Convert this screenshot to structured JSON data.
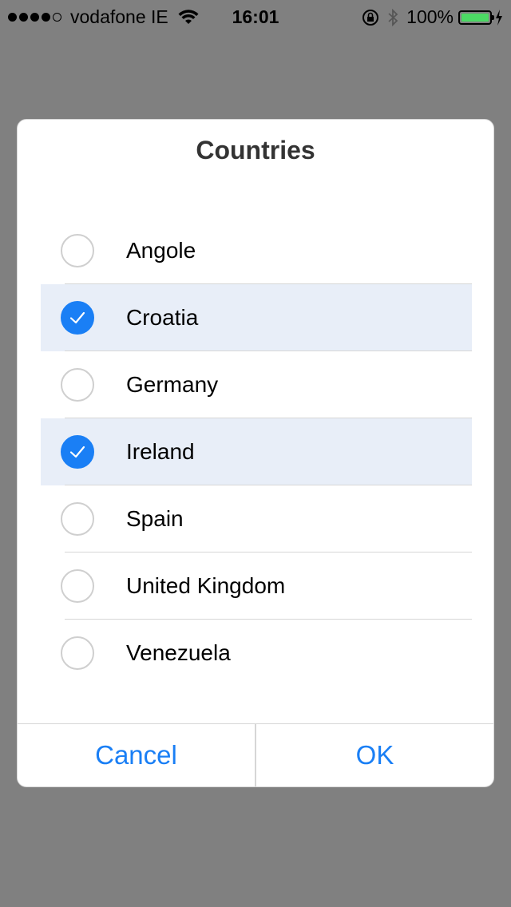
{
  "status_bar": {
    "carrier": "vodafone IE",
    "time": "16:01",
    "battery_percent": "100%",
    "signal_bars": 4,
    "icons": [
      "wifi-icon",
      "orientation-lock-icon",
      "bluetooth-icon",
      "battery-icon",
      "charging-icon"
    ]
  },
  "dialog": {
    "title": "Countries",
    "items": [
      {
        "label": "Angole",
        "checked": false
      },
      {
        "label": "Croatia",
        "checked": true
      },
      {
        "label": "Germany",
        "checked": false
      },
      {
        "label": "Ireland",
        "checked": true
      },
      {
        "label": "Spain",
        "checked": false
      },
      {
        "label": "United Kingdom",
        "checked": false
      },
      {
        "label": "Venezuela",
        "checked": false
      }
    ],
    "cancel_label": "Cancel",
    "ok_label": "OK"
  },
  "colors": {
    "accent": "#1a7ff5",
    "selected_row": "#e8eef8",
    "overlay": "#808080",
    "battery": "#4cd964"
  }
}
